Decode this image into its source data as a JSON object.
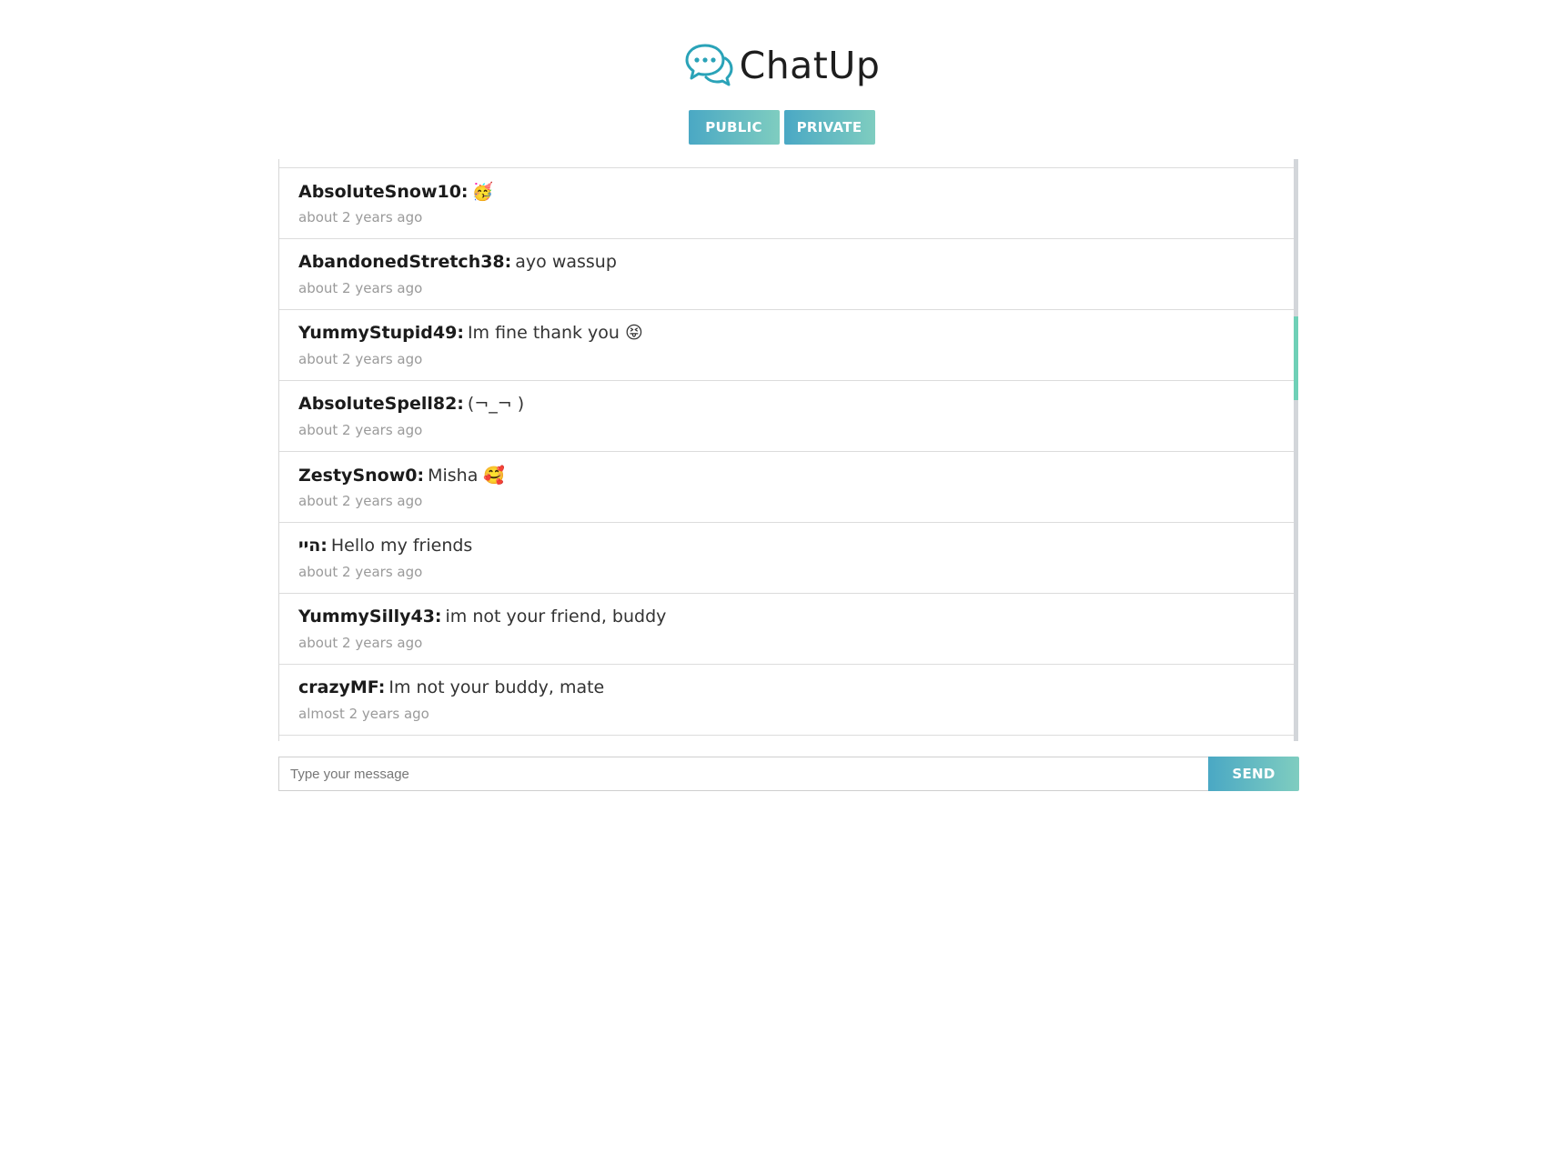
{
  "app": {
    "title": "ChatUp",
    "accent_start": "#4aa8c4",
    "accent_end": "#7fcdc0",
    "logo_icon": "chat-bubbles-icon"
  },
  "tabs": [
    {
      "label": "PUBLIC"
    },
    {
      "label": "PRIVATE"
    }
  ],
  "messages": [
    {
      "user": "AbsoluteSnow10:",
      "text": "🥳",
      "time": "about 2 years ago"
    },
    {
      "user": "AbandonedStretch38:",
      "text": "ayo wassup",
      "time": "about 2 years ago"
    },
    {
      "user": "YummyStupid49:",
      "text": "Im fine thank you 😝",
      "time": "about 2 years ago"
    },
    {
      "user": "AbsoluteSpell82:",
      "text": "(¬_¬ )",
      "time": "about 2 years ago"
    },
    {
      "user": "ZestySnow0:",
      "text": "Misha 🥰",
      "time": "about 2 years ago"
    },
    {
      "user": "היי:",
      "text": "Hello my friends",
      "time": "about 2 years ago"
    },
    {
      "user": "YummySilly43:",
      "text": "im not your friend, buddy",
      "time": "about 2 years ago"
    },
    {
      "user": "crazyMF:",
      "text": "Im not your buddy, mate",
      "time": "almost 2 years ago"
    }
  ],
  "composer": {
    "placeholder": "Type your message",
    "value": "",
    "send_label": "SEND"
  }
}
